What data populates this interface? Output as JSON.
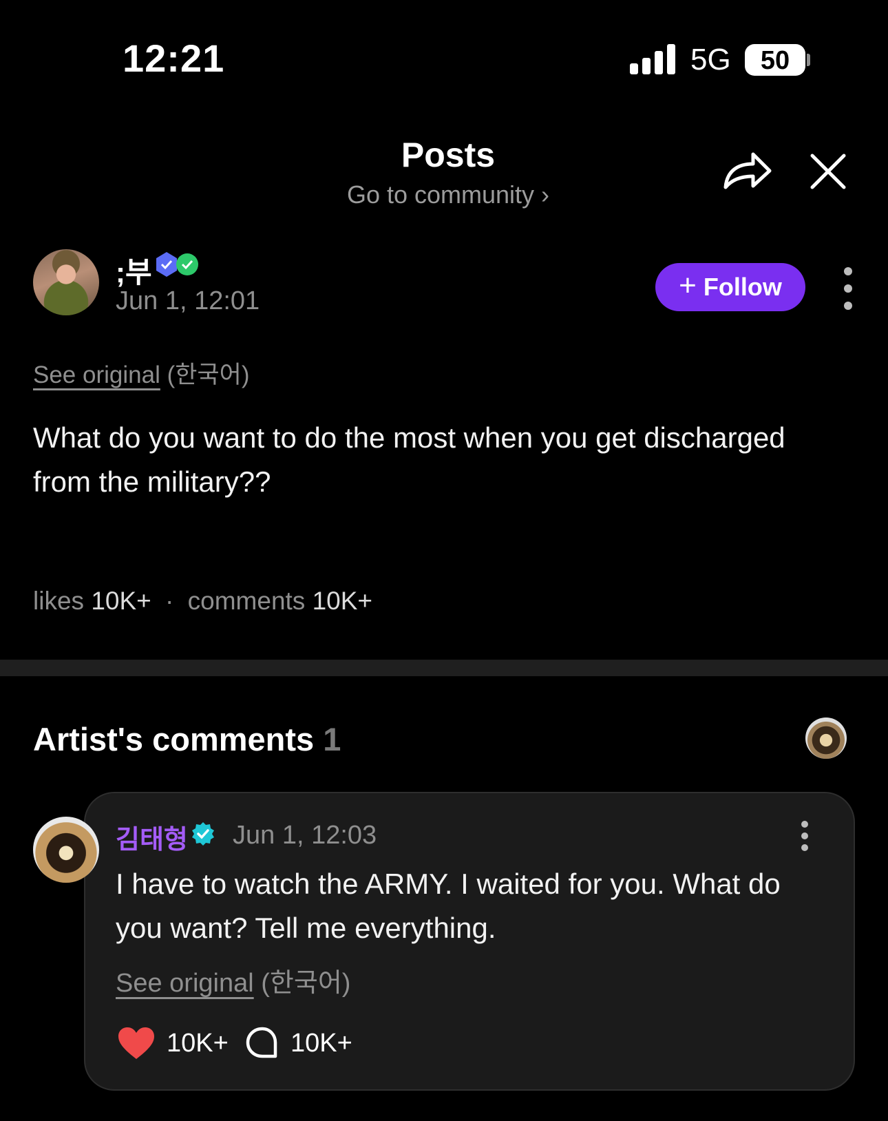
{
  "status_bar": {
    "time": "12:21",
    "network": "5G",
    "battery": "50"
  },
  "header": {
    "title": "Posts",
    "subtitle": "Go to community ›"
  },
  "post": {
    "author": ";부",
    "date": "Jun 1, 12:01",
    "follow_label": "Follow",
    "see_original": "See original",
    "language": "(한국어)",
    "text": "What do you want to do the most when you get discharged from the military??",
    "likes_label": "likes",
    "likes_value": "10K+",
    "separator": "·",
    "comments_label": "comments",
    "comments_value": "10K+"
  },
  "artist_comments": {
    "title": "Artist's comments",
    "count": "1",
    "comment": {
      "author": "김태형",
      "date": "Jun 1, 12:03",
      "text": "I have to watch the ARMY. I waited for you. What do you want? Tell me everything.",
      "see_original": "See original",
      "language": "(한국어)",
      "likes": "10K+",
      "replies": "10K+"
    }
  },
  "colors": {
    "accent": "#7a2ff0",
    "artist_name": "#a45cf7",
    "heart": "#f04a4a",
    "verified": "#1fc7d6"
  }
}
